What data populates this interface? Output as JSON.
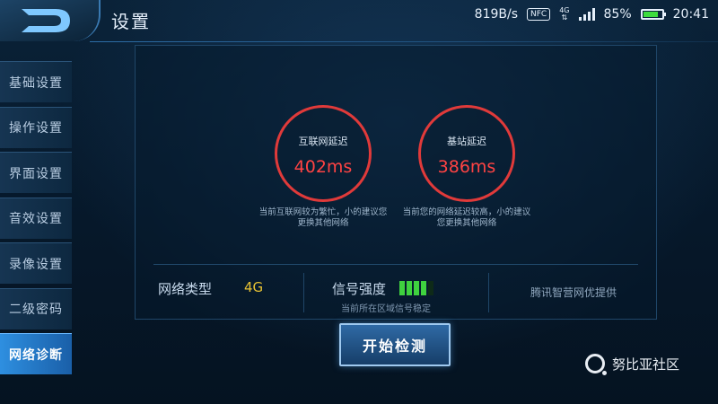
{
  "status_bar": {
    "speed": "819B/s",
    "nfc": "NFC",
    "net_type": "4G",
    "battery": "85%",
    "battery_level": 0.85,
    "time": "20:41"
  },
  "header": {
    "title": "设置"
  },
  "sidebar": {
    "items": [
      {
        "label": "基础设置",
        "active": false
      },
      {
        "label": "操作设置",
        "active": false
      },
      {
        "label": "界面设置",
        "active": false
      },
      {
        "label": "音效设置",
        "active": false
      },
      {
        "label": "录像设置",
        "active": false
      },
      {
        "label": "二级密码",
        "active": false
      },
      {
        "label": "网络诊断",
        "active": true
      }
    ]
  },
  "gauges": [
    {
      "label": "互联网延迟",
      "value": "402ms",
      "note": "当前互联网较为繁忙，小的建议您更换其他网络"
    },
    {
      "label": "基站延迟",
      "value": "386ms",
      "note": "当前您的网络延迟较高，小的建议您更换其他网络"
    }
  ],
  "info": {
    "net_type_label": "网络类型",
    "net_type_value": "4G",
    "signal_label": "信号强度",
    "signal_bars_filled": 4,
    "signal_bars_total": 5,
    "signal_note": "当前所在区域信号稳定",
    "provider": "腾讯智营网优提供"
  },
  "start_button": "开始检测",
  "watermark": "努比亚社区",
  "colors": {
    "accent": "#2e8fe0",
    "latency_ring": "#e03a3a",
    "signal": "#3fd23f",
    "net_value": "#e8c233"
  }
}
